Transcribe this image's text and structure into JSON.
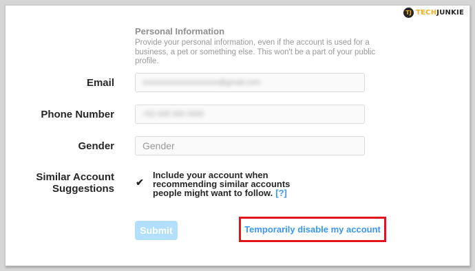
{
  "watermark": {
    "logo_letter": "TJ",
    "brand_tech": "TECH",
    "brand_junkie": "JUNKIE"
  },
  "section": {
    "title": "Personal Information",
    "description": "Provide your personal information, even if the account is used for a business, a pet or something else. This won't be a part of your public profile."
  },
  "fields": {
    "email_label": "Email",
    "email_value": "xxxxxxxxxxxxxxxxxxxx@gmail.com",
    "phone_label": "Phone Number",
    "phone_value": "+62 000 000 0000",
    "gender_label": "Gender",
    "gender_placeholder": "Gender"
  },
  "similar": {
    "label": "Similar Account Suggestions",
    "checked": true,
    "check_text": "Include your account when recommending similar accounts people might want to follow.",
    "help_link": "[?]"
  },
  "actions": {
    "submit_label": "Submit",
    "disable_label": "Temporarily disable my account"
  },
  "colors": {
    "link": "#3897f0",
    "highlight": "#e3121b",
    "submit_disabled": "#b2dffc"
  }
}
